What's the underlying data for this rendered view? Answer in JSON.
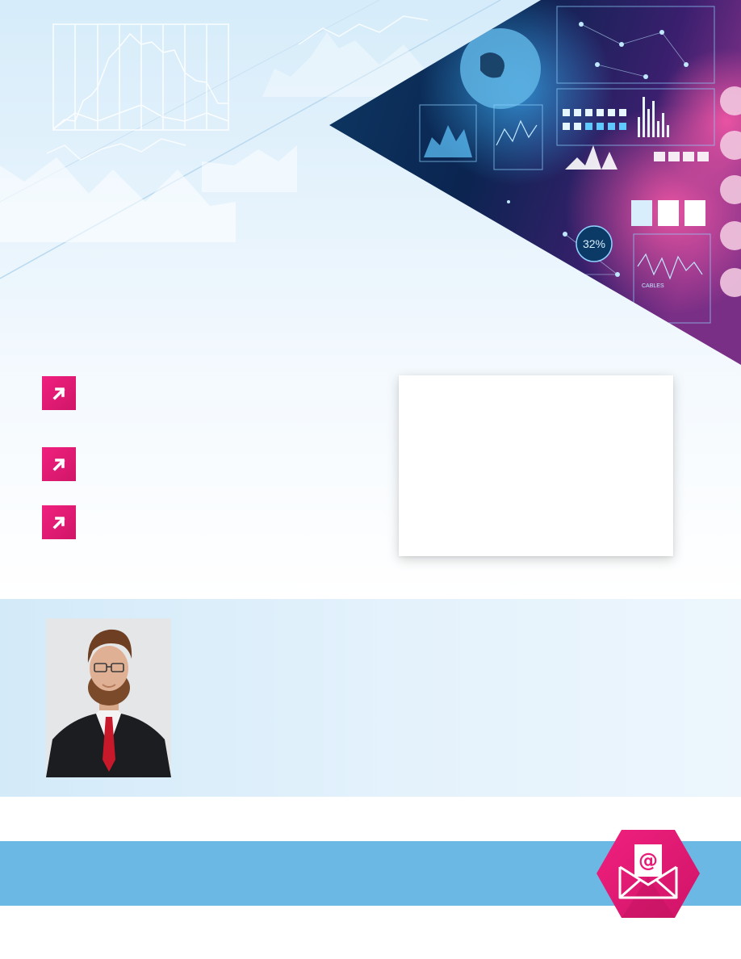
{
  "hero": {
    "percent_label": "32%",
    "cables_label": "CABLES"
  },
  "bullets": [
    {
      "icon": "arrow-up-right-icon",
      "text": ""
    },
    {
      "icon": "arrow-up-right-icon",
      "text": ""
    },
    {
      "icon": "arrow-up-right-icon",
      "text": ""
    }
  ],
  "info_card": {
    "text": ""
  },
  "author": {
    "bio": ""
  },
  "contact": {
    "text": "",
    "icon": "email-at-icon"
  },
  "colors": {
    "accent_pink": "#e81b77",
    "contact_bar": "#6cb8e4",
    "hero_bg": "#d6ecfa"
  }
}
